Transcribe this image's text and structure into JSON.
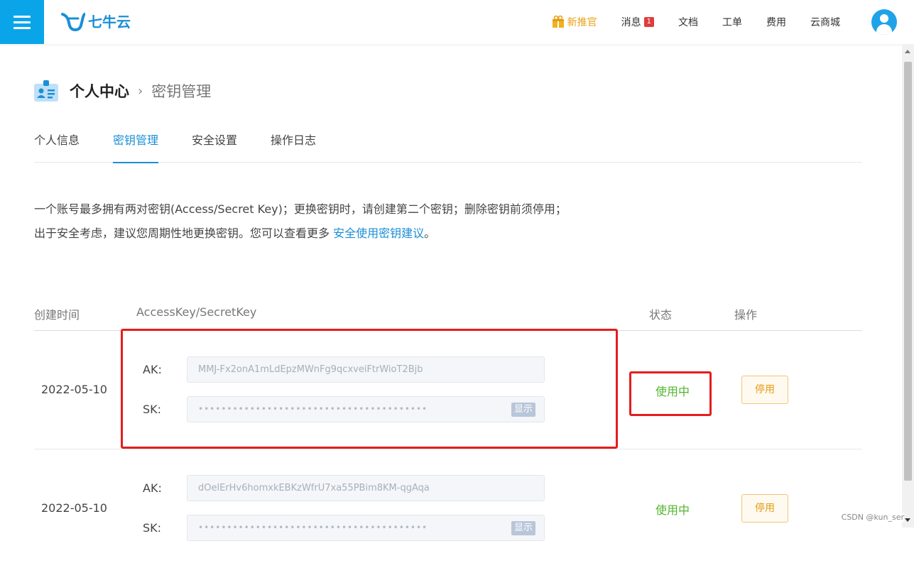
{
  "header": {
    "brand": "七牛云",
    "nav": [
      {
        "label": "新推官",
        "promo": true
      },
      {
        "label": "消息",
        "badge": "1"
      },
      {
        "label": "文档"
      },
      {
        "label": "工单"
      },
      {
        "label": "费用"
      },
      {
        "label": "云商城"
      }
    ]
  },
  "breadcrumb": {
    "main": "个人中心",
    "separator": "›",
    "sub": "密钥管理"
  },
  "tabs": [
    "个人信息",
    "密钥管理",
    "安全设置",
    "操作日志"
  ],
  "active_tab": "密钥管理",
  "description": {
    "text": "一个账号最多拥有两对密钥(Access/Secret Key)；更换密钥时，请创建第二个密钥；删除密钥前须停用；出于安全考虑，建议您周期性地更换密钥。您可以查看更多",
    "link": "安全使用密钥建议",
    "end": "。"
  },
  "table": {
    "headers": {
      "date": "创建时间",
      "keys": "AccessKey/SecretKey",
      "status": "状态",
      "action": "操作"
    },
    "rows": [
      {
        "date": "2022-05-10",
        "ak_label": "AK:",
        "ak": "MMJ-Fx2onA1mLdEpzMWnFg9qcxveiFtrWioT2Bjb",
        "sk_label": "SK:",
        "sk": "••••••••••••••••••••••••••••••••••••••••",
        "show_label": "显示",
        "status": "使用中",
        "action": "停用"
      },
      {
        "date": "2022-05-10",
        "ak_label": "AK:",
        "ak": "dOelErHv6homxkEBKzWfrU7xa55PBim8KM-qgAqa",
        "sk_label": "SK:",
        "sk": "••••••••••••••••••••••••••••••••••••••••",
        "show_label": "显示",
        "status": "使用中",
        "action": "停用"
      }
    ]
  },
  "watermark": "CSDN @kun_ser",
  "colors": {
    "accent": "#1a8fd6",
    "menu": "#0aa5e9",
    "status_ok": "#52b52e",
    "warn": "#e59a12",
    "highlight": "#e51d1d"
  }
}
